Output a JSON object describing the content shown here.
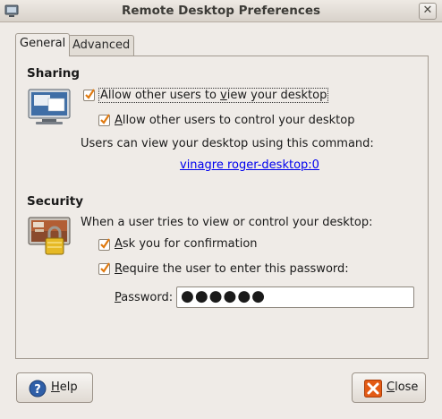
{
  "window": {
    "title": "Remote Desktop Preferences",
    "close_glyph": "✕",
    "icon": "remote-desktop-icon"
  },
  "tabs": [
    {
      "label": "General",
      "selected": true
    },
    {
      "label": "Advanced",
      "selected": false
    }
  ],
  "sharing": {
    "heading": "Sharing",
    "icon": "monitor-icon",
    "allow_view": {
      "label_pre": "Allow other users to ",
      "mnemonic": "v",
      "label_post": "iew your desktop",
      "checked": true
    },
    "allow_control": {
      "label_pre": "",
      "mnemonic": "A",
      "label_post": "llow other users to control your desktop",
      "checked": true
    },
    "command_intro": "Users can view your desktop using this command:",
    "command": "vinagre roger-desktop:0"
  },
  "security": {
    "heading": "Security",
    "icon": "locked-screen-icon",
    "intro": "When a user tries to view or control your desktop:",
    "ask_confirmation": {
      "label_pre": "",
      "mnemonic": "A",
      "label_post": "sk you for confirmation",
      "checked": true
    },
    "require_password": {
      "label_pre": "",
      "mnemonic": "R",
      "label_post": "equire the user to enter this password:",
      "checked": true
    },
    "password_label_mnemonic": "P",
    "password_label_rest": "assword:",
    "password_value": "●●●●●●"
  },
  "buttons": {
    "help": {
      "mnemonic": "H",
      "rest": "elp",
      "icon": "help-icon"
    },
    "close": {
      "mnemonic": "C",
      "rest": "lose",
      "icon": "close-icon"
    }
  },
  "colors": {
    "link": "#0000ee",
    "checkmark": "#e07a10",
    "help_icon": "#2f5fa8",
    "close_icon": "#e35a14"
  }
}
